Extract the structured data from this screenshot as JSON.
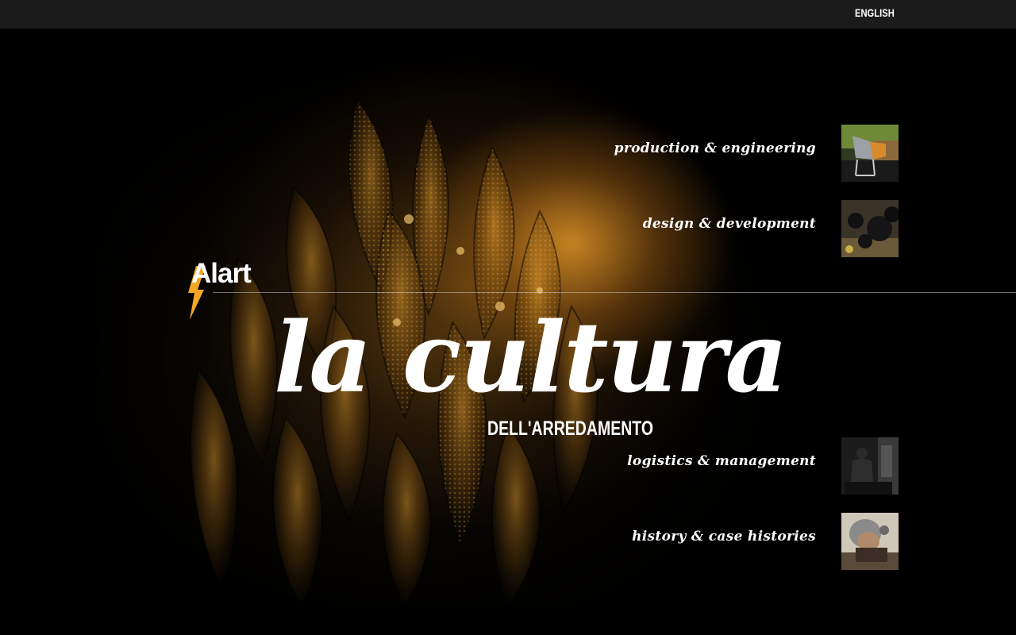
{
  "topbar": {
    "language_link": "ENGLISH"
  },
  "logo": {
    "text": "Alart",
    "accent_color": "#f5a623"
  },
  "hero": {
    "headline": "la cultura",
    "subheadline": "DELL'ARREDAMENTO"
  },
  "menu": {
    "items": [
      {
        "label": "production & engineering",
        "thumb_icon": "office-chair-photo"
      },
      {
        "label": "design & development",
        "thumb_icon": "black-spheres-photo"
      },
      {
        "label": "logistics & management",
        "thumb_icon": "warehouse-worker-photo"
      },
      {
        "label": "history & case histories",
        "thumb_icon": "craftsman-photo"
      }
    ]
  },
  "colors": {
    "background": "#000000",
    "topbar": "#1b1b1b",
    "text": "#ffffff",
    "glow": "#e29628"
  }
}
